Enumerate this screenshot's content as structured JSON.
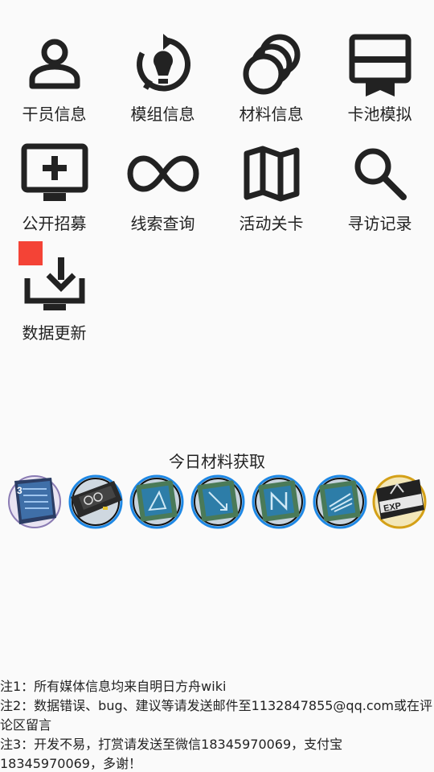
{
  "menu": [
    {
      "label": "干员信息",
      "icon": "person-icon"
    },
    {
      "label": "模组信息",
      "icon": "bulb-refresh-icon"
    },
    {
      "label": "材料信息",
      "icon": "coins-icon"
    },
    {
      "label": "卡池模拟",
      "icon": "card-bookmark-icon"
    },
    {
      "label": "公开招募",
      "icon": "monitor-plus-icon"
    },
    {
      "label": "线索查询",
      "icon": "infinity-icon"
    },
    {
      "label": "活动关卡",
      "icon": "map-icon"
    },
    {
      "label": "寻访记录",
      "icon": "search-icon"
    },
    {
      "label": "数据更新",
      "icon": "download-icon"
    }
  ],
  "materials_title": "今日材料获取",
  "materials": [
    {
      "icon": "skill-summary-book-icon"
    },
    {
      "icon": "lmd-chip-icon"
    },
    {
      "icon": "chip-triangle-icon"
    },
    {
      "icon": "chip-arrow-icon"
    },
    {
      "icon": "chip-n-icon"
    },
    {
      "icon": "chip-wing-icon"
    },
    {
      "icon": "exp-card-icon"
    }
  ],
  "notes": [
    "注1：所有媒体信息均来自明日方舟wiki",
    "注2：数据错误、bug、建议等请发送邮件至1132847855@qq.com或在评论区留言",
    "注3：开发不易，打赏请发送至微信18345970069，支付宝18345970069，多谢！"
  ],
  "colors": {
    "icon": "#222222",
    "badge": "#f44336",
    "chip_ring": "#1e88e5",
    "chip_green": "#4a7a58",
    "gold": "#d4a017"
  }
}
